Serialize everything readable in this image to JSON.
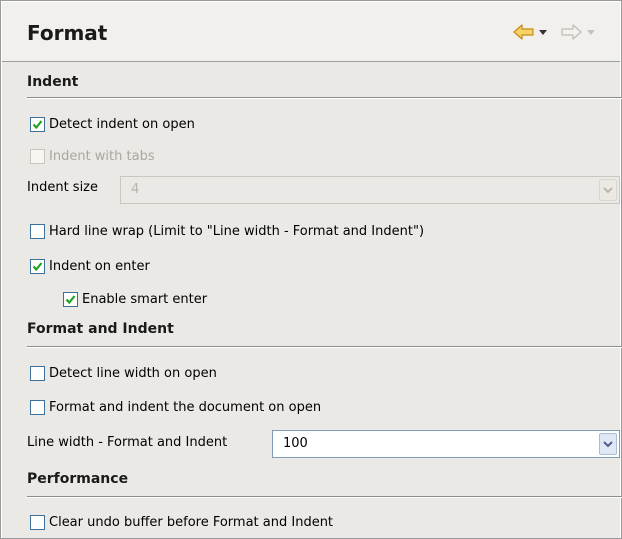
{
  "header": {
    "title": "Format",
    "back_icon": "left-arrow-icon",
    "forward_icon": "right-arrow-icon"
  },
  "colors": {
    "check": "#21a121",
    "header_bg": "#f1f0ec",
    "body_bg": "#ebe9e5",
    "nav_arrow": "#e8b21f"
  },
  "sections": {
    "indent": "Indent",
    "format_and_indent": "Format and Indent",
    "performance": "Performance"
  },
  "options": {
    "detect_indent": {
      "label": "Detect indent on open",
      "checked": true
    },
    "indent_with_tabs": {
      "label": "Indent with tabs",
      "checked": false,
      "disabled": true
    },
    "hard_line_wrap": {
      "label": "Hard line wrap (Limit to \"Line width - Format and Indent\")",
      "checked": false
    },
    "indent_on_enter": {
      "label": "Indent on enter",
      "checked": true
    },
    "smart_enter": {
      "label": "Enable smart enter",
      "checked": true
    },
    "detect_line_width": {
      "label": "Detect line width on open",
      "checked": false
    },
    "format_on_open": {
      "label": "Format and indent the document on open",
      "checked": false
    },
    "clear_undo": {
      "label": "Clear undo buffer before Format and Indent",
      "checked": false
    }
  },
  "fields": {
    "indent_size": {
      "label": "Indent size",
      "value": "4",
      "disabled": true
    },
    "line_width": {
      "label": "Line width - Format and Indent",
      "value": "100"
    }
  }
}
